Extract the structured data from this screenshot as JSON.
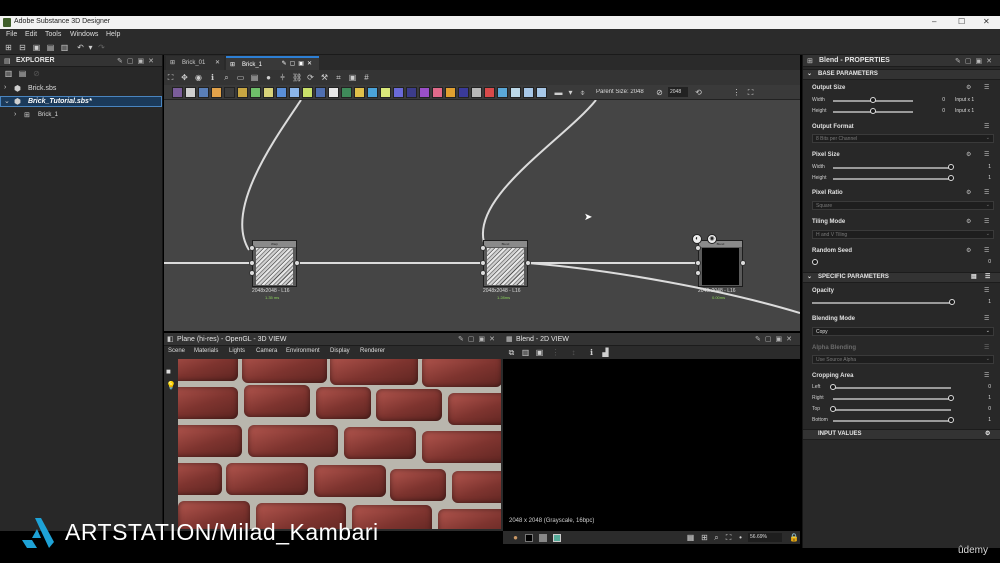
{
  "app": {
    "title": "Adobe Substance 3D Designer",
    "window_controls": [
      "–",
      "☐",
      "✕"
    ]
  },
  "menu": [
    "File",
    "Edit",
    "Tools",
    "Windows",
    "Help"
  ],
  "explorer": {
    "title": "EXPLORER",
    "items": [
      {
        "label": "Brick.sbs",
        "level": 0
      },
      {
        "label": "Brick_Tutorial.sbs*",
        "level": 0,
        "selected": true
      },
      {
        "label": "Brick_1",
        "level": 1
      }
    ]
  },
  "graph": {
    "tabs": [
      {
        "label": "Brick_01",
        "active": false
      },
      {
        "label": "Brick_1",
        "active": true
      }
    ],
    "parent_size_label": "Parent Size: 2048",
    "size_value": "2048",
    "nodes": [
      {
        "title": "Warp",
        "resolution": "2048x2048 - L16",
        "time": "1.35 ms"
      },
      {
        "title": "Blend",
        "resolution": "2048x2048 - L16",
        "time": "1.28ms"
      },
      {
        "title": "Blend",
        "resolution": "2048x2048 - L16",
        "time": "0.00ms"
      }
    ]
  },
  "view3d": {
    "title": "Plane (hi-res) - OpenGL - 3D VIEW",
    "menu": [
      "Scene",
      "Materials",
      "Lights",
      "Camera",
      "Environment",
      "Display",
      "Renderer"
    ]
  },
  "view2d": {
    "title": "Blend - 2D VIEW",
    "image_info": "2048 x 2048 (Grayscale, 16bpc)",
    "zoom": "56.69%"
  },
  "properties": {
    "title": "Blend - PROPERTIES",
    "base_section": "BASE PARAMETERS",
    "output_size": {
      "label": "Output Size",
      "width_label": "Width",
      "width_value": "0",
      "width_mode": "Input x 1",
      "height_label": "Height",
      "height_value": "0",
      "height_mode": "Input x 1",
      "width_fraction": 0.5,
      "height_fraction": 0.5
    },
    "output_format": {
      "label": "Output Format",
      "value": "8 Bits per Channel"
    },
    "pixel_size": {
      "label": "Pixel Size",
      "width_label": "Width",
      "width_value": "1",
      "height_label": "Height",
      "height_value": "1"
    },
    "pixel_ratio": {
      "label": "Pixel Ratio",
      "value": "Square"
    },
    "tiling_mode": {
      "label": "Tiling Mode",
      "value": "H and V Tiling"
    },
    "random_seed": {
      "label": "Random Seed",
      "value": "0"
    },
    "specific_section": "SPECIFIC PARAMETERS",
    "opacity": {
      "label": "Opacity",
      "value": "1"
    },
    "blending_mode": {
      "label": "Blending Mode",
      "value": "Copy"
    },
    "alpha_blending": {
      "label": "Alpha Blending",
      "value": "Use Source Alpha"
    },
    "cropping": {
      "label": "Cropping Area",
      "rows": [
        {
          "label": "Left",
          "value": "0",
          "fraction": 0
        },
        {
          "label": "Right",
          "value": "1",
          "fraction": 1
        },
        {
          "label": "Top",
          "value": "0",
          "fraction": 0
        },
        {
          "label": "Bottom",
          "value": "1",
          "fraction": 1
        }
      ]
    },
    "input_section": "INPUT VALUES"
  },
  "overlay": {
    "watermark": "ARTSTATION/Milad_Kambari",
    "udemy": "ûdemy"
  }
}
